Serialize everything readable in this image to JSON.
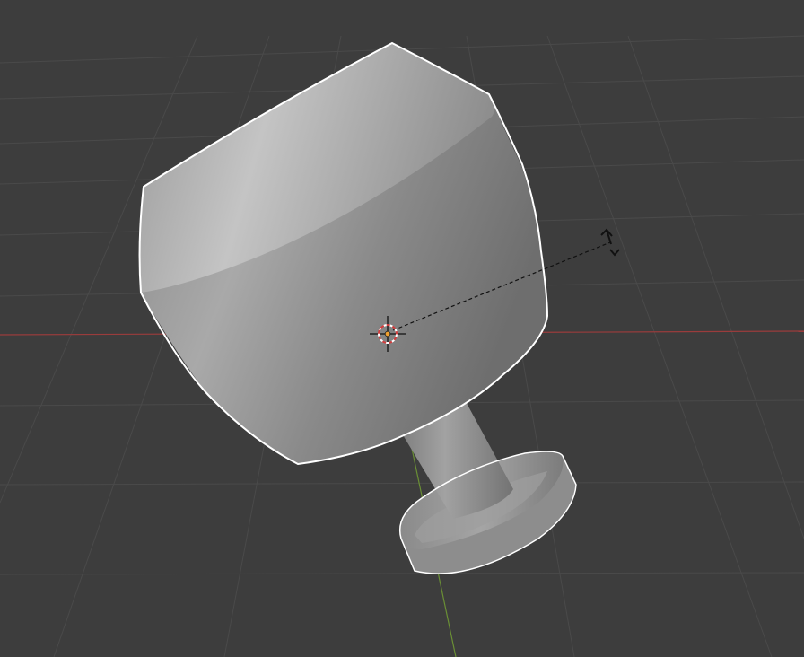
{
  "viewport": {
    "name": "3D Viewport",
    "background": "#3d3d3d",
    "grid_color": "#4a4a4a",
    "x_axis_color": "#9a3c3c",
    "y_axis_color": "#6a8f35"
  },
  "object": {
    "name": "wine-glass-mesh",
    "selected": true,
    "outline_color": "#ffffff",
    "shading": "solid-gray"
  },
  "gizmos": {
    "origin_icon": "3d-cursor-origin-icon",
    "transform_icon": "rotate-arrows-icon"
  }
}
